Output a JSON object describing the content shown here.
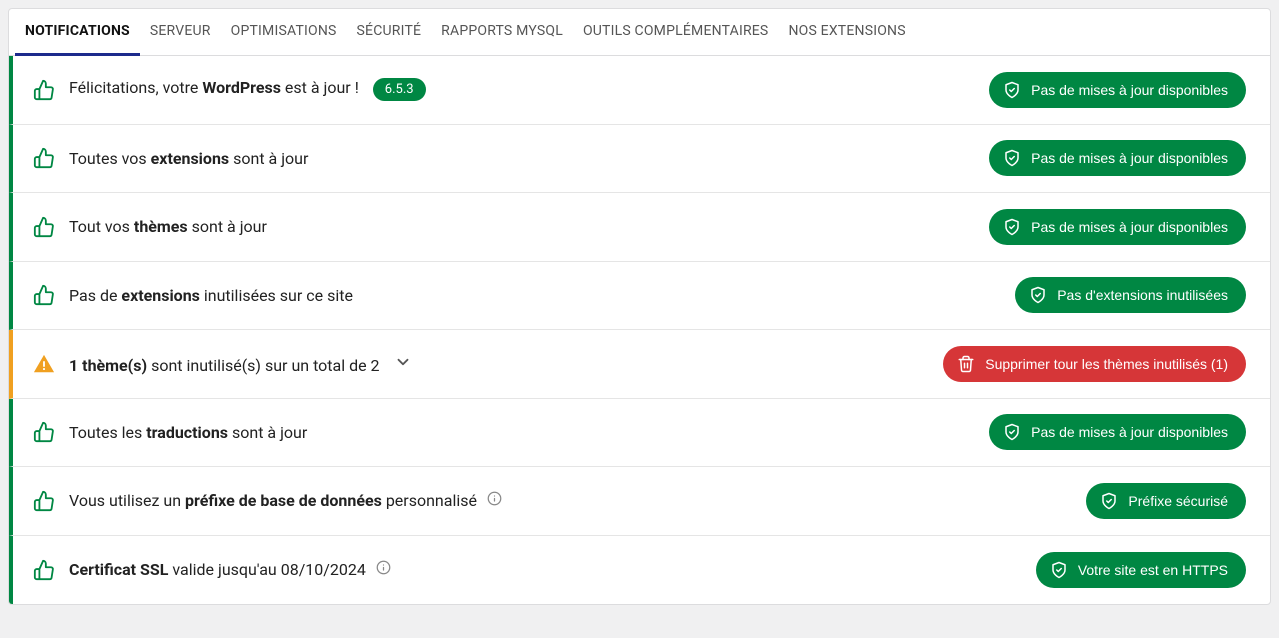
{
  "tabs": [
    {
      "label": "NOTIFICATIONS",
      "active": true
    },
    {
      "label": "SERVEUR"
    },
    {
      "label": "OPTIMISATIONS"
    },
    {
      "label": "SÉCURITÉ"
    },
    {
      "label": "RAPPORTS MYSQL"
    },
    {
      "label": "OUTILS COMPLÉMENTAIRES"
    },
    {
      "label": "NOS EXTENSIONS"
    }
  ],
  "rows": [
    {
      "status": "ok",
      "msg_pre": "Félicitations, votre ",
      "msg_bold": "WordPress",
      "msg_post": " est à jour !",
      "version_badge": "6.5.3",
      "pill_icon": "shield",
      "pill_label": "Pas de mises à jour disponibles"
    },
    {
      "status": "ok",
      "msg_pre": "Toutes vos ",
      "msg_bold": "extensions",
      "msg_post": " sont à jour",
      "pill_icon": "shield",
      "pill_label": "Pas de mises à jour disponibles"
    },
    {
      "status": "ok",
      "msg_pre": "Tout vos ",
      "msg_bold": "thèmes",
      "msg_post": " sont à jour",
      "pill_icon": "shield",
      "pill_label": "Pas de mises à jour disponibles"
    },
    {
      "status": "ok",
      "msg_pre": "Pas de ",
      "msg_bold": "extensions",
      "msg_post": " inutilisées sur ce site",
      "pill_icon": "shield",
      "pill_label": "Pas d'extensions inutilisées"
    },
    {
      "status": "warn",
      "msg_pre": "",
      "msg_bold": "1 thème(s)",
      "msg_post": " sont inutilisé(s) sur un total de 2",
      "chevron": true,
      "pill_icon": "trash",
      "pill_label": "Supprimer tour les thèmes inutilisés (1)"
    },
    {
      "status": "ok",
      "msg_pre": "Toutes les ",
      "msg_bold": "traductions",
      "msg_post": " sont à jour",
      "pill_icon": "shield",
      "pill_label": "Pas de mises à jour disponibles"
    },
    {
      "status": "ok",
      "msg_pre": "Vous utilisez un ",
      "msg_bold": "préfixe de base de données",
      "msg_post": " personnalisé",
      "info": true,
      "pill_icon": "shield",
      "pill_label": "Préfixe sécurisé"
    },
    {
      "status": "ok",
      "msg_pre": "",
      "msg_bold": "Certificat SSL",
      "msg_post": " valide jusqu'au 08/10/2024",
      "info": true,
      "pill_icon": "shield",
      "pill_label": "Votre site est en HTTPS"
    }
  ]
}
